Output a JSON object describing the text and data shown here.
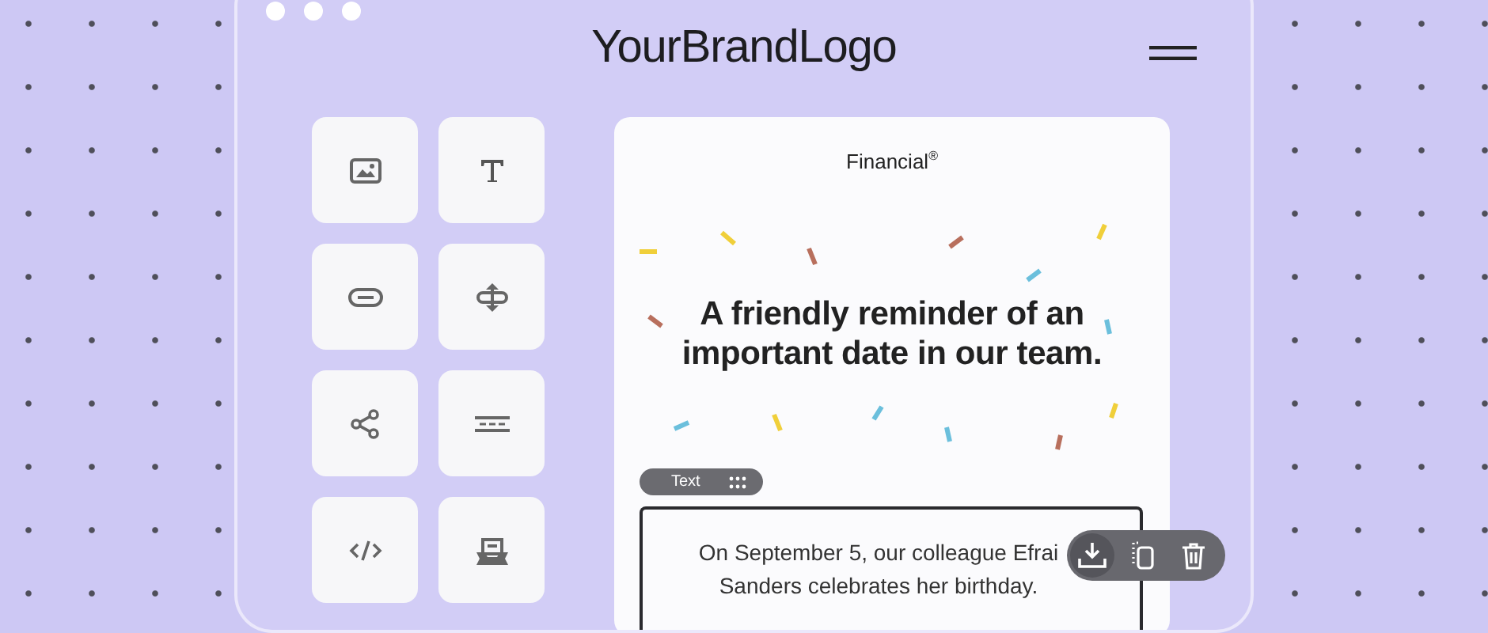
{
  "header": {
    "logo": "YourBrandLogo"
  },
  "blocks": [
    {
      "kind": "image"
    },
    {
      "kind": "text"
    },
    {
      "kind": "button"
    },
    {
      "kind": "spacer"
    },
    {
      "kind": "social"
    },
    {
      "kind": "divider"
    },
    {
      "kind": "html"
    },
    {
      "kind": "banner"
    }
  ],
  "email": {
    "brand": "Financial$^{®}$",
    "headline": "A friendly reminder of an important date in our team.",
    "text_block": {
      "tag": "Text",
      "lines": [
        "On September 5, our colleague Efrai",
        "Sanders celebrates her birthday."
      ]
    },
    "actions": [
      {
        "kind": "save",
        "selected": true
      },
      {
        "kind": "duplicate",
        "selected": false
      },
      {
        "kind": "delete",
        "selected": false
      }
    ]
  }
}
